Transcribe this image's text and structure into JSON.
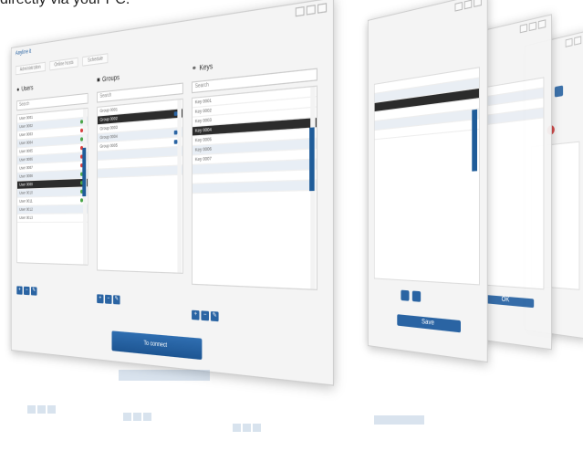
{
  "caption": "directly via your PC.",
  "main_window": {
    "app_title": "Anyline it",
    "tabs": [
      "Administration",
      "Online hosts",
      "Schedule"
    ],
    "columns": [
      {
        "icon": "user-icon",
        "heading": "Users",
        "search_placeholder": "Search",
        "rows": [
          "User 0001",
          "User 0002",
          "User 0003",
          "User 0004",
          "User 0005",
          "User 0006",
          "User 0007",
          "User 0008",
          "User 0009",
          "User 0010",
          "User 0011",
          "User 0012",
          "User 0013"
        ]
      },
      {
        "icon": "group-icon",
        "heading": "Groups",
        "search_placeholder": "Search",
        "rows": [
          "Group 0001",
          "Group 0002",
          "Group 0003",
          "Group 0004",
          "Group 0005"
        ]
      },
      {
        "icon": "key-icon",
        "heading": "Keys",
        "search_placeholder": "Search",
        "rows": [
          "Key 0001",
          "Key 0002",
          "Key 0003",
          "Key 0004",
          "Key 0005",
          "Key 0006",
          "Key 0007"
        ]
      }
    ],
    "connect_button": "To connect"
  },
  "back_window_1": {
    "button_left": "",
    "button_right": "Save"
  },
  "back_window_2": {
    "button": "OK"
  }
}
